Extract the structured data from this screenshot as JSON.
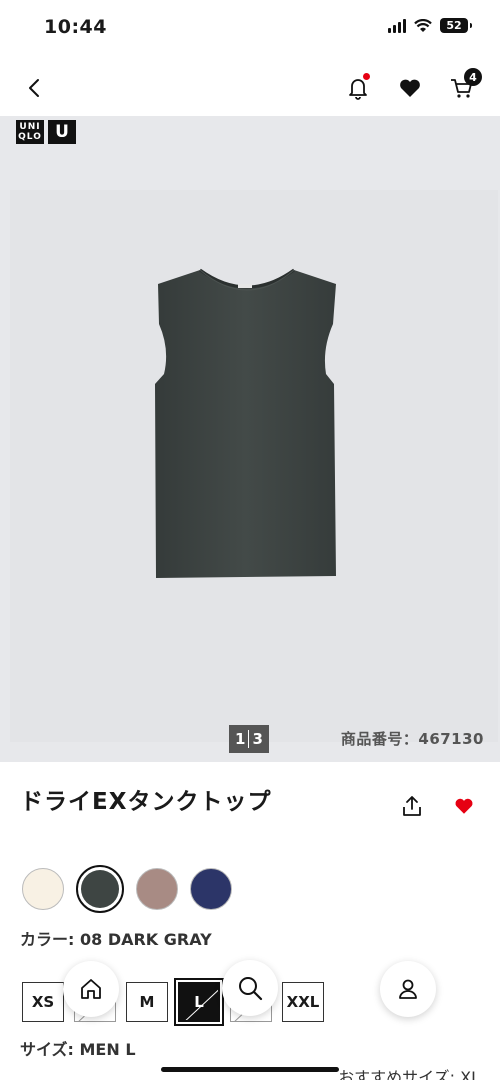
{
  "status_bar": {
    "time": "10:44",
    "battery": "52"
  },
  "nav": {
    "cart_count": "4"
  },
  "brand": {
    "logo_line1": "UNI",
    "logo_line2": "QLO",
    "logo_u": "U"
  },
  "gallery": {
    "page_current": "1",
    "page_total": "3",
    "product_number": "商品番号：467130"
  },
  "product": {
    "title": "ドライEXタンクトップ"
  },
  "colors": {
    "label_prefix": "カラー: ",
    "selected_value": "08 DARK GRAY",
    "swatches": [
      {
        "name": "off-white",
        "hex": "#f8f1e4"
      },
      {
        "name": "dark-gray",
        "hex": "#3e4543"
      },
      {
        "name": "brown",
        "hex": "#a88b84"
      },
      {
        "name": "navy",
        "hex": "#2c3568"
      }
    ]
  },
  "sizes": {
    "options": [
      {
        "label": "XS",
        "state": "available"
      },
      {
        "label": "S",
        "state": "disabled"
      },
      {
        "label": "M",
        "state": "available"
      },
      {
        "label": "L",
        "state": "selected"
      },
      {
        "label": "XL",
        "state": "disabled"
      },
      {
        "label": "XXL",
        "state": "available"
      }
    ],
    "label_prefix": "サイズ: ",
    "selected_value": "MEN L"
  },
  "recommend": {
    "label": "おすすめサイズ: XL"
  },
  "icons": {
    "back": "chevron-left-icon",
    "bell": "bell-icon",
    "heart": "heart-icon",
    "cart": "cart-icon",
    "share": "share-icon",
    "home": "home-icon",
    "search": "search-icon",
    "account": "person-icon"
  },
  "theme": {
    "accent": "#e60012",
    "product_color": "#3e4543"
  }
}
